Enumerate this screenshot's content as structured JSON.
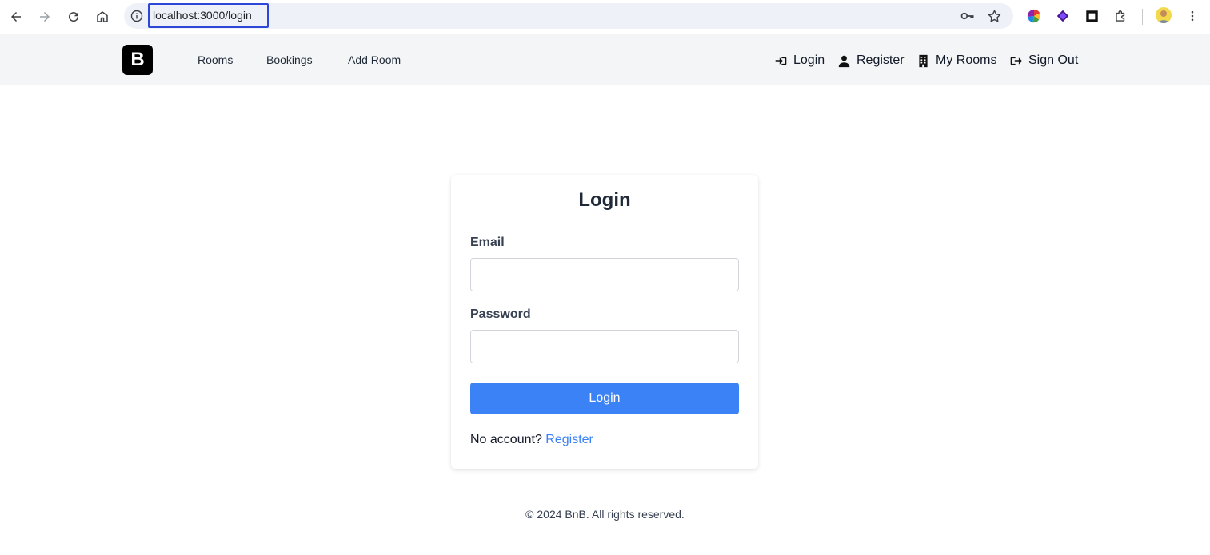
{
  "browser": {
    "url": "localhost:3000/login"
  },
  "navbar": {
    "logo_letter": "B",
    "links": [
      "Rooms",
      "Bookings",
      "Add Room"
    ],
    "right_links": [
      {
        "label": "Login",
        "icon": "sign-in-icon"
      },
      {
        "label": "Register",
        "icon": "user-icon"
      },
      {
        "label": "My Rooms",
        "icon": "building-icon"
      },
      {
        "label": "Sign Out",
        "icon": "sign-out-icon"
      }
    ]
  },
  "login_form": {
    "title": "Login",
    "email_label": "Email",
    "email_value": "",
    "password_label": "Password",
    "password_value": "",
    "submit_label": "Login",
    "no_account_text": "No account?",
    "register_link": "Register"
  },
  "footer": {
    "text": "© 2024 BnB. All rights reserved."
  },
  "colors": {
    "primary": "#3b82f6",
    "nav_bg": "#f4f5f6",
    "url_highlight": "#2c47d8"
  }
}
